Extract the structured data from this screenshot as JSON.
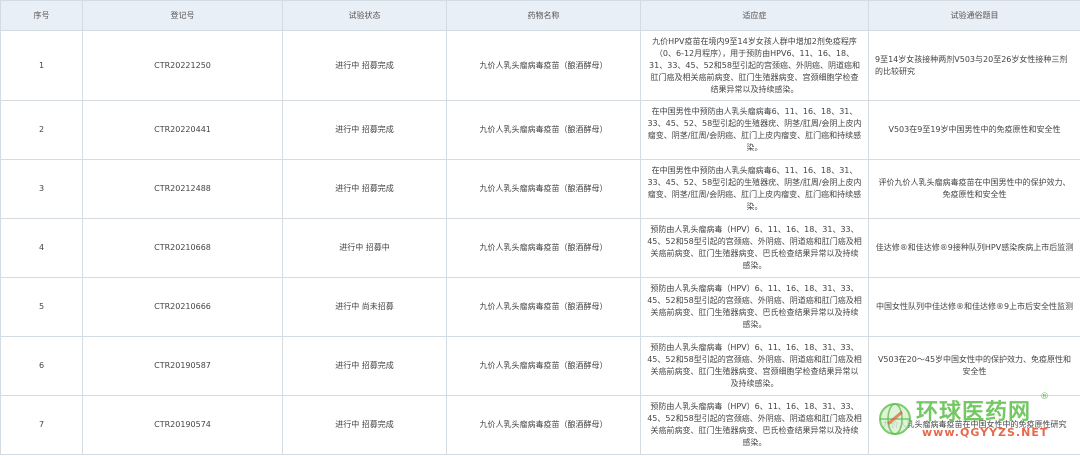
{
  "headers": [
    "序号",
    "登记号",
    "试验状态",
    "药物名称",
    "适应症",
    "试验通俗题目"
  ],
  "rows": [
    {
      "no": "1",
      "reg": "CTR20221250",
      "status": "进行中 招募完成",
      "drug": "九价人乳头瘤病毒疫苗（酿酒酵母）",
      "indication": "九价HPV疫苗在境内9至14岁女孩人群中增加2剂免疫程序（0、6-12月程序），用于预防由HPV6、11、16、18、31、33、45、52和58型引起的宫颈癌、外阴癌、阴道癌和肛门癌及相关癌前病变、肛门生殖器病变、宫颈细胞学检查结果异常以及持续感染。",
      "title": "9至14岁女孩接种两剂V503与20至26岁女性接种三剂的比较研究"
    },
    {
      "no": "2",
      "reg": "CTR20220441",
      "status": "进行中 招募完成",
      "drug": "九价人乳头瘤病毒疫苗（酿酒酵母）",
      "indication": "在中国男性中预防由人乳头瘤病毒6、11、16、18、31、33、45、52、58型引起的生殖器疣、阴茎/肛周/会阴上皮内瘤变、阴茎/肛周/会阴癌、肛门上皮内瘤变、肛门癌和持续感染。",
      "title": "V503在9至19岁中国男性中的免疫原性和安全性"
    },
    {
      "no": "3",
      "reg": "CTR20212488",
      "status": "进行中 招募完成",
      "drug": "九价人乳头瘤病毒疫苗（酿酒酵母）",
      "indication": "在中国男性中预防由人乳头瘤病毒6、11、16、18、31、33、45、52、58型引起的生殖器疣、阴茎/肛周/会阴上皮内瘤变、阴茎/肛周/会阴癌、肛门上皮内瘤变、肛门癌和持续感染。",
      "title": "评价九价人乳头瘤病毒疫苗在中国男性中的保护效力、免疫原性和安全性"
    },
    {
      "no": "4",
      "reg": "CTR20210668",
      "status": "进行中 招募中",
      "drug": "九价人乳头瘤病毒疫苗（酿酒酵母）",
      "indication": "预防由人乳头瘤病毒（HPV）6、11、16、18、31、33、45、52和58型引起的宫颈癌、外阴癌、阴道癌和肛门癌及相关癌前病变、肛门生殖器病变、巴氏检查结果异常以及持续感染。",
      "title": "佳达修®和佳达修®9接种队列HPV感染疾病上市后监测"
    },
    {
      "no": "5",
      "reg": "CTR20210666",
      "status": "进行中 尚未招募",
      "drug": "九价人乳头瘤病毒疫苗（酿酒酵母）",
      "indication": "预防由人乳头瘤病毒（HPV）6、11、16、18、31、33、45、52和58型引起的宫颈癌、外阴癌、阴道癌和肛门癌及相关癌前病变、肛门生殖器病变、巴氏检查结果异常以及持续感染。",
      "title": "中国女性队列中佳达修®和佳达修®9上市后安全性监测"
    },
    {
      "no": "6",
      "reg": "CTR20190587",
      "status": "进行中 招募完成",
      "drug": "九价人乳头瘤病毒疫苗（酿酒酵母）",
      "indication": "预防由人乳头瘤病毒（HPV）6、11、16、18、31、33、45、52和58型引起的宫颈癌、外阴癌、阴道癌和肛门癌及相关癌前病变、肛门生殖器病变、宫颈细胞学检查结果异常以及持续感染。",
      "title": "V503在20～45岁中国女性中的保护效力、免疫原性和安全性"
    },
    {
      "no": "7",
      "reg": "CTR20190574",
      "status": "进行中 招募完成",
      "drug": "九价人乳头瘤病毒疫苗（酿酒酵母）",
      "indication": "预防由人乳头瘤病毒（HPV）6、11、16、18、31、33、45、52和58型引起的宫颈癌、外阴癌、阴道癌和肛门癌及相关癌前病变、肛门生殖器病变、巴氏检查结果异常以及持续感染。",
      "title": "九价人乳头瘤病毒疫苗在中国女性中的免疫原性研究"
    }
  ],
  "watermark": {
    "name": "环球医药网",
    "reg": "®",
    "url": "www.QGYYZS.NET",
    "color": "#5cbf4a"
  }
}
